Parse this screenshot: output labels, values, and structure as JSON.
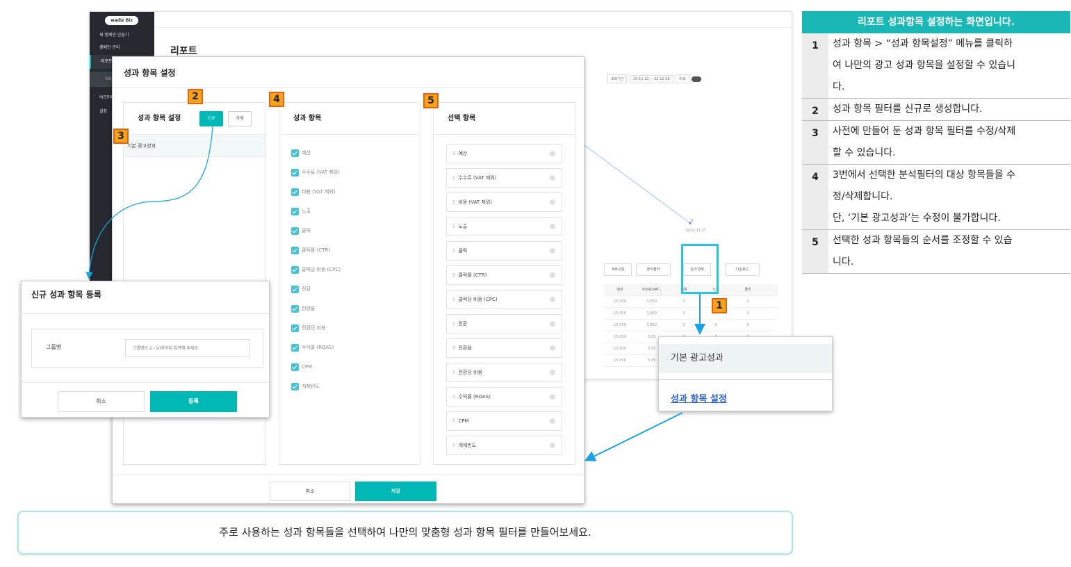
{
  "app": {
    "logo": "wadiz Biz",
    "sidebar": [
      "새 캠페인 만들기",
      "캠페인 관리",
      "리포트",
      "비즈머니",
      "설정"
    ],
    "sidebar_sub": "리포트",
    "page_title": "리포트",
    "toolbar": {
      "period_label": "조회기간",
      "period": "22-11-22 ~ 22-11-28",
      "compare": "비교"
    },
    "chart_point_label": "2022-11-27",
    "chart_zero": "0",
    "buttons": {
      "refresh": "새로고침",
      "analysis": "분석필터",
      "metrics": "성과 항목",
      "download": "다운로드"
    },
    "table_header": [
      "예산",
      "수수료(VAT...",
      "비용",
      "노출",
      "클릭"
    ],
    "table_rows": [
      [
        "15,000",
        "5,850",
        "0",
        "0",
        "0"
      ],
      [
        "15,000",
        "5,850",
        "0",
        "0",
        "0"
      ],
      [
        "15,000",
        "5,850",
        "0",
        "0",
        "0"
      ],
      [
        "15,000",
        "5,85",
        "0",
        "0",
        "0"
      ],
      [
        "15,000",
        "5,85",
        "0",
        "0",
        "0"
      ],
      [
        "15,000",
        "5,85",
        "0",
        "0",
        "0"
      ]
    ]
  },
  "modal": {
    "title": "성과 항목 설정",
    "col1_title": "성과 항목 설정",
    "btn_new": "신규",
    "btn_delete": "삭제",
    "filter_item": "기본 광고성과",
    "col2_title": "성과 항목",
    "col3_title": "선택 항목",
    "metrics": [
      "예산",
      "수수료 (VAT 제외)",
      "비용 (VAT 제외)",
      "노출",
      "클릭",
      "클릭률 (CTR)",
      "클릭당 비용 (CPC)",
      "전환",
      "전환율",
      "전환당 비용",
      "수익률 (ROAS)",
      "CPM",
      "게재빈도"
    ],
    "cancel": "취소",
    "save": "저장"
  },
  "register": {
    "title": "신규 성과 항목 등록",
    "label": "그룹명",
    "placeholder": "그룹명은 2~10자까지 입력해 주세요.",
    "cancel": "취소",
    "submit": "등록"
  },
  "popup": {
    "item1": "기본 광고성과",
    "item2": "성과 항목 설정"
  },
  "markers": [
    "1",
    "2",
    "3",
    "4",
    "5"
  ],
  "panel": {
    "header": "리포트 성과항목 설정하는 화면입니다.",
    "rows": [
      {
        "num": "1",
        "lines": [
          "성과 항목 > “성과 항목설정” 메뉴를 클릭하",
          "여 나만의 광고 성과 항목을 설정할 수 있습니",
          "다."
        ]
      },
      {
        "num": "2",
        "lines": [
          "성과 항목 필터를 신규로 생성합니다."
        ]
      },
      {
        "num": "3",
        "lines": [
          "사전에 만들어 둔 성과 항목 필터를 수정/삭제",
          "할 수 있습니다."
        ]
      },
      {
        "num": "4",
        "lines": [
          "3번에서 선택한 분석필터의 대상 항목들을 수",
          "정/삭제합니다.",
          "단, ‘기본 광고성과’는 수정이 불가합니다."
        ]
      },
      {
        "num": "5",
        "lines": [
          "선택한 성과 항목들의 순서를 조정할 수 있습",
          "니다."
        ]
      }
    ]
  },
  "caption": "주로 사용하는 성과 항목들을 선택하여 나만의 맞춤형 성과 항목 필터를 만들어보세요.",
  "colors": {
    "accent": "#00b8b5",
    "panel_header": "#19b7b5",
    "marker": "#f7a21b",
    "arrow": "#1aa3e0",
    "link": "#2d62c8"
  }
}
